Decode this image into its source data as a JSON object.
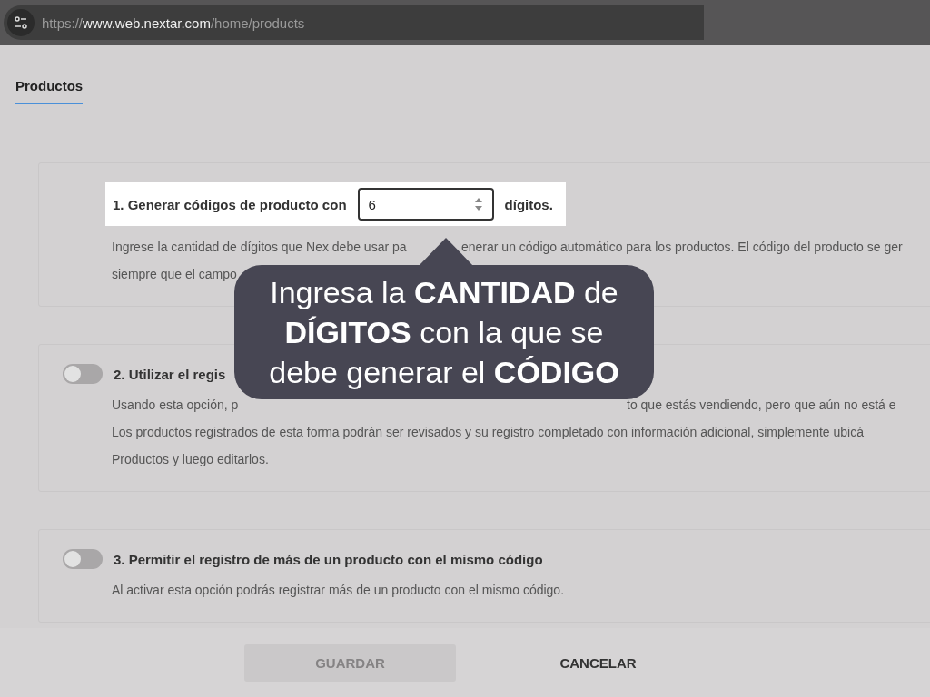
{
  "address_bar": {
    "scheme": "https://",
    "host": "www.web.nextar.com",
    "path": "/home/products"
  },
  "tabs": [
    {
      "label": "Productos",
      "selected": true
    }
  ],
  "settings": [
    {
      "kind": "number",
      "highlighted": true,
      "label": "1. Generar códigos de producto con",
      "value": "6",
      "suffix": "dígitos.",
      "lines": [
        [
          "Ingrese la cantidad de dígitos que Nex debe usar pa",
          "enerar un código automático para los productos. El código del producto se ger"
        ],
        [
          "siempre que el campo"
        ]
      ]
    },
    {
      "kind": "toggle",
      "on": false,
      "label": "2. Utilizar el regis",
      "lines": [
        [
          "Usando esta opción, p",
          "to que estás vendiendo, pero que aún no está e"
        ],
        [
          "Los productos registrados de esta forma podrán ser revisados y su registro completado con información adicional, simplemente ubicá"
        ],
        [
          "Productos y luego editarlos."
        ]
      ]
    },
    {
      "kind": "toggle",
      "on": false,
      "label": "3. Permitir el registro de más de un producto con el mismo código",
      "lines": [
        [
          "Al activar esta opción podrás registrar más de un producto con el mismo código."
        ]
      ]
    }
  ],
  "tooltip": {
    "text": "Ingresa la **CANTIDAD** de **DÍGITOS** con la que se debe generar el **CÓDIGO**"
  },
  "buttons": [
    {
      "label": "GUARDAR",
      "disabled": true
    },
    {
      "label": "CANCELAR",
      "disabled": false
    }
  ]
}
